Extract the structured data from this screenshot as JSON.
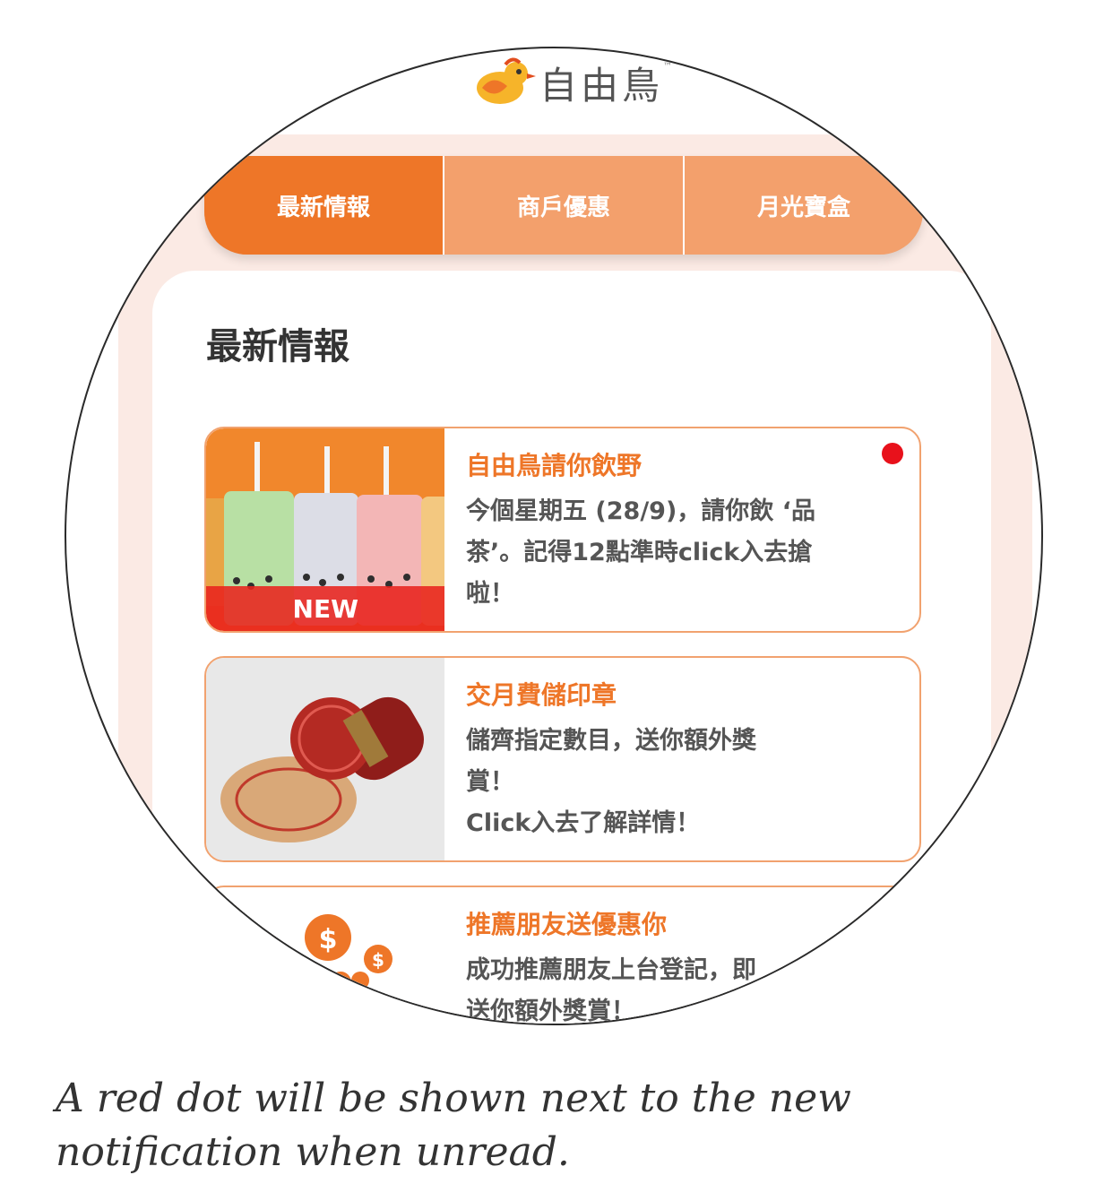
{
  "app": {
    "logo_text": "自由鳥",
    "logo_tm": "™"
  },
  "tabs": [
    {
      "label": "最新情報",
      "active": true
    },
    {
      "label": "商戶優惠",
      "active": false
    },
    {
      "label": "月光寶盒",
      "active": false
    }
  ],
  "section": {
    "title": "最新情報"
  },
  "cards": [
    {
      "title": "自由鳥請你飲野",
      "body": "今個星期五 (28/9)，請你飲 ‘品\n茶’。記得12點準時click入去搶\n啦！",
      "badge": "NEW",
      "unread": true,
      "image_icon": "bubble-tea-image"
    },
    {
      "title": "交月費儲印章",
      "body": "儲齊指定數目，送你額外獎\n賞！\nClick入去了解詳情！",
      "image_icon": "rubber-stamp-image"
    },
    {
      "title": "推薦朋友送優惠你",
      "body": "成功推薦朋友上台登記，即\n送你額外獎賞！",
      "image_icon": "coins-image"
    }
  ],
  "caption": "A red dot will be shown next to the new notification when unread.",
  "colors": {
    "accent": "#ee7628",
    "tab_inactive": "#f3a06c",
    "unread_dot": "#e8111b",
    "page_bg": "#fbeae4"
  }
}
